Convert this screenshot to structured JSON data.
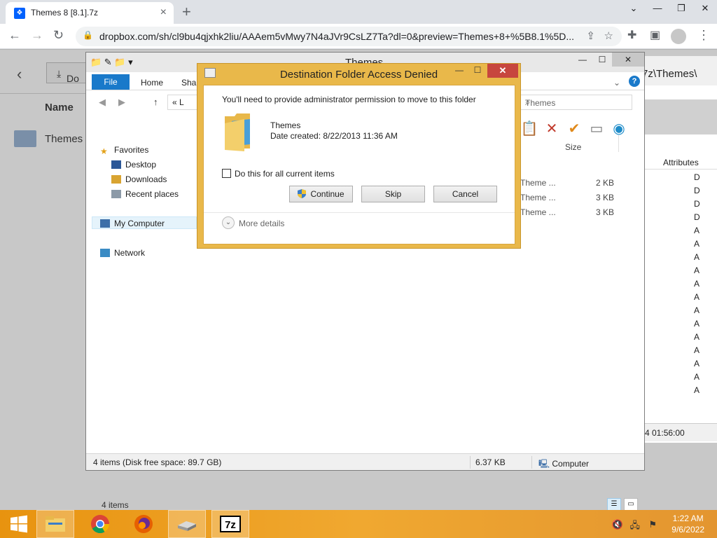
{
  "browser": {
    "tab_title": "Themes 8 [8.1].7z",
    "url": "dropbox.com/sh/cl9bu4qjxhk2liu/AAAem5vMwy7N4aJVr9CsLZ7Ta?dl=0&preview=Themes+8+%5B8.1%5D..."
  },
  "dropbox": {
    "download_label": "Do",
    "column_name": "Name",
    "row_name": "Themes"
  },
  "sevenzip": {
    "path_fragment": "7z\\Themes\\",
    "column_attributes": "Attributes",
    "attributes": [
      "D",
      "D",
      "D",
      "D",
      "A",
      "A",
      "A",
      "A",
      "A",
      "A",
      "A",
      "A",
      "A",
      "A",
      "A",
      "A",
      "A"
    ],
    "status_time": "4 01:56:00"
  },
  "explorer": {
    "title": "Themes",
    "ribbon_file": "File",
    "ribbon_home": "Home",
    "ribbon_share": "Shar",
    "address_text": "«  L",
    "search_text": "Themes",
    "nav": {
      "favorites": "Favorites",
      "desktop": "Desktop",
      "downloads": "Downloads",
      "recent": "Recent places",
      "my_computer": "My Computer",
      "network": "Network"
    },
    "column_size": "Size",
    "files": [
      {
        "type": "Theme ...",
        "size": "2 KB"
      },
      {
        "type": "Theme ...",
        "size": "3 KB"
      },
      {
        "type": "Theme ...",
        "size": "3 KB"
      }
    ],
    "item_count": "4 items",
    "status_left": "4 items (Disk free space: 89.7 GB)",
    "status_size": "6.37 KB",
    "status_location": "Computer"
  },
  "dialog": {
    "title": "Destination Folder Access Denied",
    "message": "You'll need to provide administrator permission to move to this folder",
    "folder_name": "Themes",
    "date_created": "Date created: 8/22/2013 11:36 AM",
    "checkbox_label": "Do this for all current items",
    "continue_label": "Continue",
    "skip_label": "Skip",
    "cancel_label": "Cancel",
    "more_details": "More details"
  },
  "taskbar": {
    "time": "1:22 AM",
    "date": "9/6/2022"
  },
  "colors": {
    "taskbar": "#f0a830",
    "dialog_frame": "#e9b84a",
    "accent_blue": "#1979ca",
    "close_red": "#c7463e"
  }
}
